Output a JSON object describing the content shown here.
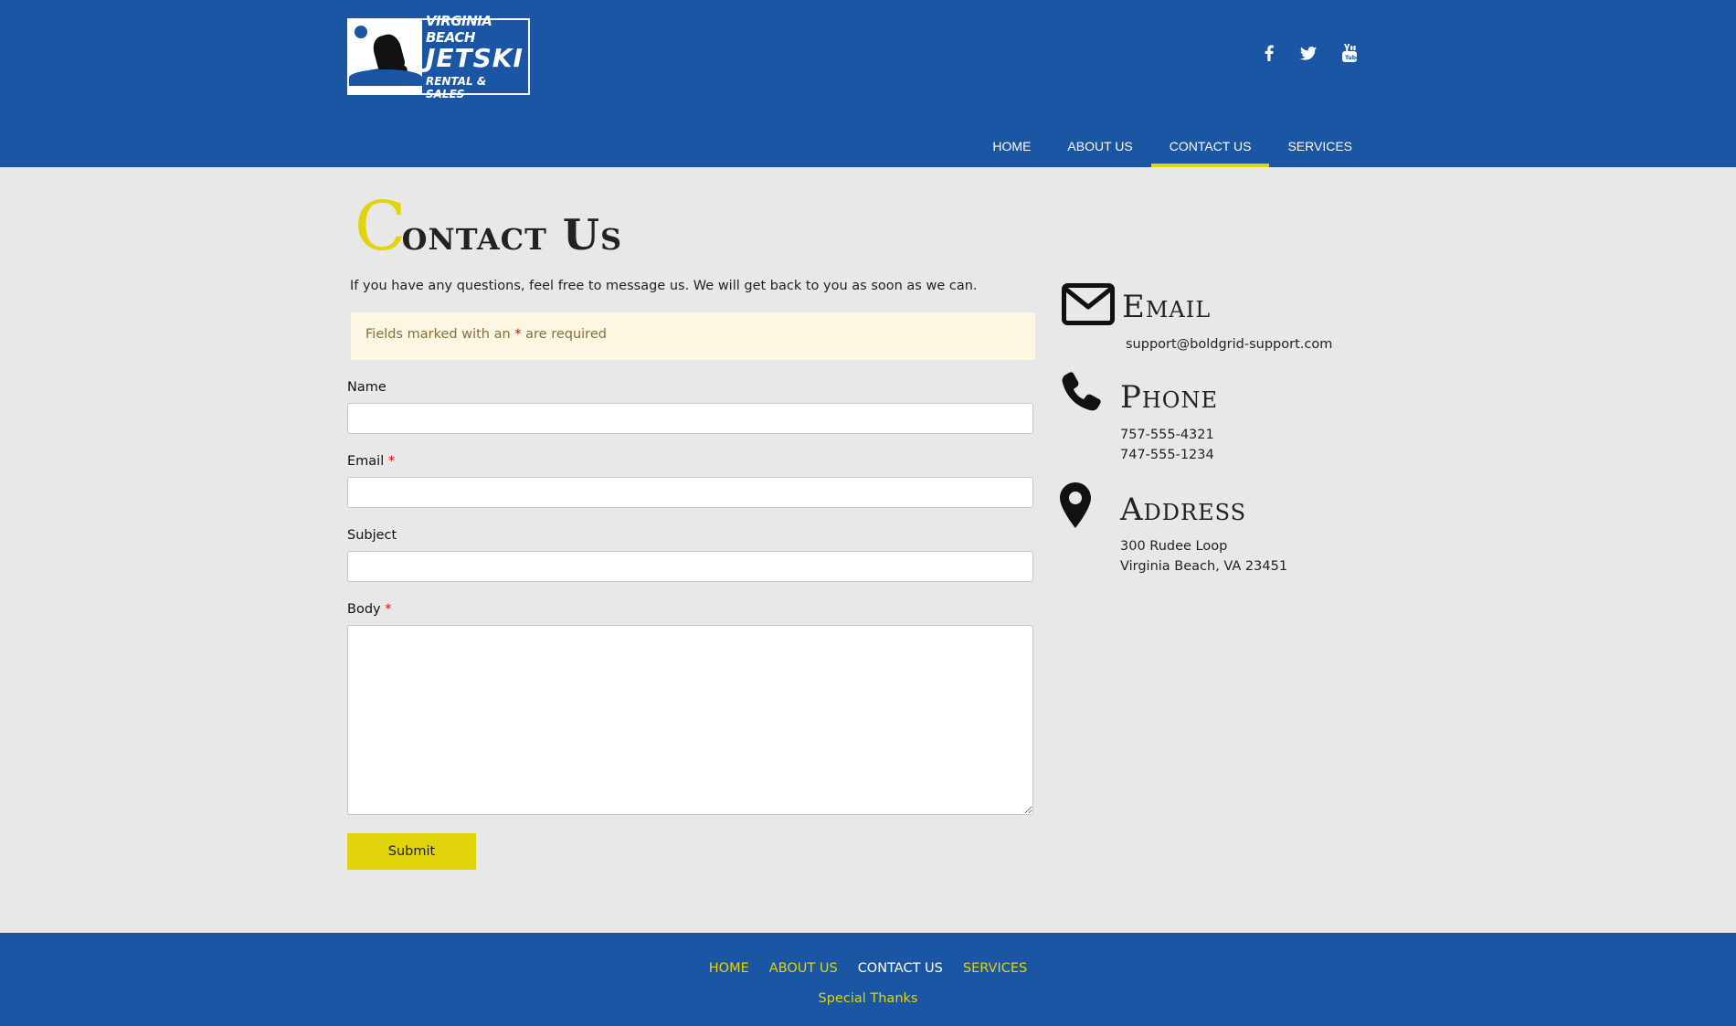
{
  "header": {
    "logo": {
      "line1": "VIRGINIA BEACH",
      "line2": "JETSKI",
      "line3": "RENTAL & SALES"
    },
    "social": [
      {
        "icon": "facebook-icon"
      },
      {
        "icon": "twitter-icon"
      },
      {
        "icon": "youtube-icon"
      }
    ],
    "nav": [
      {
        "label": "HOME",
        "active": false
      },
      {
        "label": "ABOUT US",
        "active": false
      },
      {
        "label": "CONTACT US",
        "active": true
      },
      {
        "label": "SERVICES",
        "active": false
      }
    ]
  },
  "main": {
    "title_first": "C",
    "title_rest": "ontact Us",
    "intro": "If you have any questions, feel free to message us. We will get back to you as soon as we can.",
    "notice": {
      "before": "Fields marked with an ",
      "asterisk": "*",
      "after": " are required"
    },
    "form": {
      "name_label": "Name",
      "name_value": "",
      "email_label": "Email",
      "email_required": "*",
      "email_value": "",
      "subject_label": "Subject",
      "subject_value": "",
      "body_label": "Body",
      "body_required": "*",
      "body_value": "",
      "submit_label": "Submit"
    }
  },
  "contact_info": {
    "email": {
      "heading": "Email",
      "value": "support@boldgrid-support.com"
    },
    "phone": {
      "heading": "Phone",
      "line1": "757-555-4321",
      "line2": "747-555-1234"
    },
    "address": {
      "heading": "Address",
      "line1": "300 Rudee Loop",
      "line2": "Virginia Beach, VA 23451"
    }
  },
  "footer": {
    "links": [
      {
        "label": "HOME",
        "current": false
      },
      {
        "label": "ABOUT US",
        "current": false
      },
      {
        "label": "CONTACT US",
        "current": true
      },
      {
        "label": "SERVICES",
        "current": false
      }
    ],
    "special_thanks": "Special Thanks"
  },
  "colors": {
    "brand_blue": "#1a56a3",
    "accent_yellow": "#e2d40b",
    "background": "#e8e8e8",
    "notice_bg": "#fdf6e3"
  }
}
